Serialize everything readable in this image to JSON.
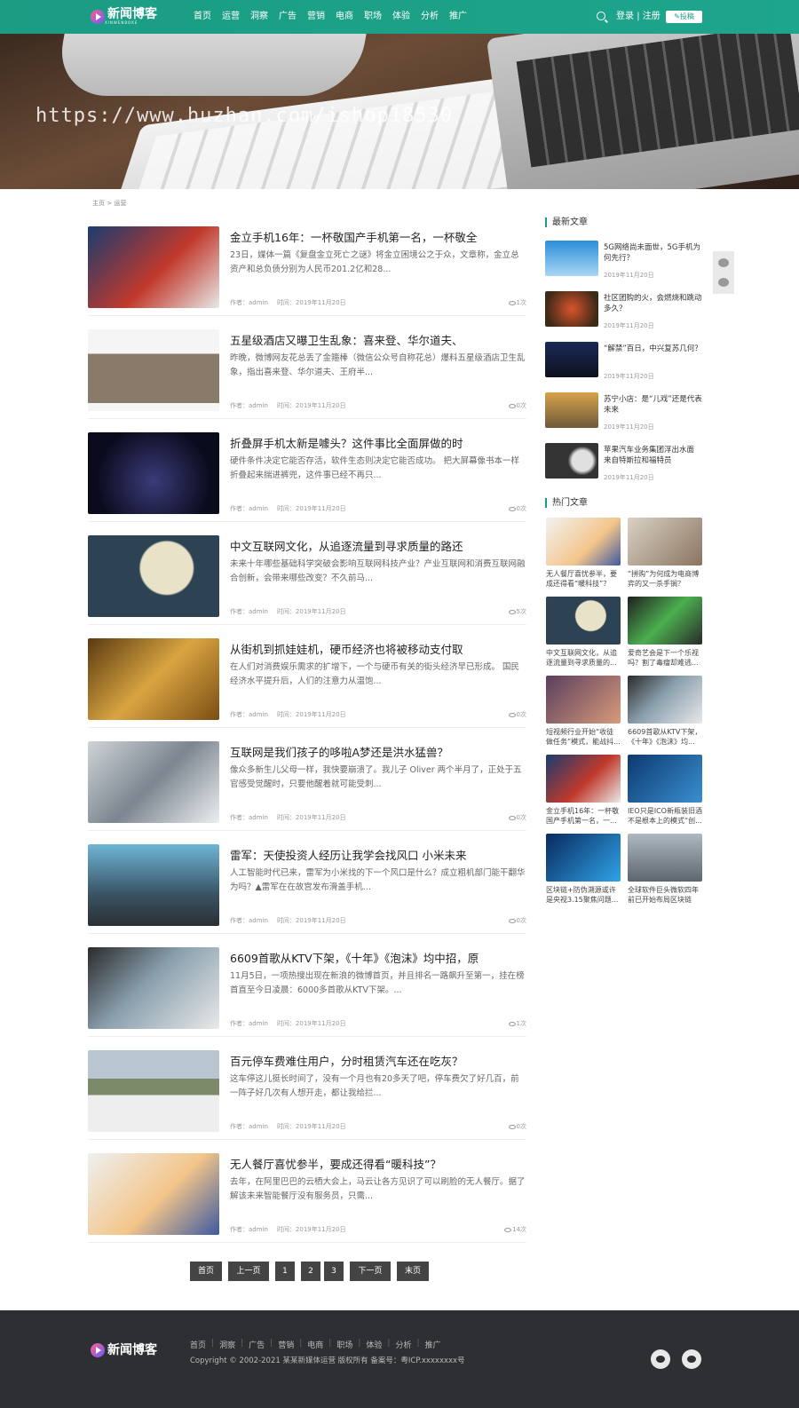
{
  "header": {
    "logo_text": "新闻博客",
    "logo_sub": "XINWENBOKE",
    "nav": [
      "首页",
      "运营",
      "洞察",
      "广告",
      "营销",
      "电商",
      "职场",
      "体验",
      "分析",
      "推广"
    ],
    "login": "登录",
    "sep": "|",
    "register": "注册",
    "post": "✎投稿"
  },
  "banner": {
    "watermark": "https://www.huzhan.com/ishop18530"
  },
  "breadcrumb": "主页 > 运营",
  "articles": [
    {
      "title": "金立手机16年：一杯敬国产手机第一名，一杯敬全",
      "desc": "23日，媒体一篇《复盘金立死亡之谜》将金立困境公之于众，文章称，金立总资产和总负债分别为人民币201.2亿和28...",
      "author": "作者：admin",
      "date": "时间：2019年11月20日",
      "views": "1次"
    },
    {
      "title": "五星级酒店又曝卫生乱象：喜来登、华尔道夫、",
      "desc": "昨晚，微博网友花总丢了金箍棒（微信公众号自称花总）爆料五星级酒店卫生乱象，指出喜来登、华尔道夫、王府半...",
      "author": "作者：admin",
      "date": "时间：2019年11月20日",
      "views": "0次"
    },
    {
      "title": "折叠屏手机太新是噱头？这件事比全面屏做的时",
      "desc": "硬件条件决定它能否存活，软件生态则决定它能否成功。 把大屏幕像书本一样折叠起来揣进裤兜，这件事已经不再只...",
      "author": "作者：admin",
      "date": "时间：2019年11月20日",
      "views": "0次"
    },
    {
      "title": "中文互联网文化，从追逐流量到寻求质量的路还",
      "desc": "未来十年哪些基础科学突破会影响互联网科技产业？产业互联网和消费互联网融合创新，会带来哪些改变？不久前马...",
      "author": "作者：admin",
      "date": "时间：2019年11月20日",
      "views": "5次"
    },
    {
      "title": "从街机到抓娃娃机，硬币经济也将被移动支付取",
      "desc": "在人们对消费娱乐需求的扩增下，一个与硬币有关的街头经济早已形成。 国民经济水平提升后，人们的注意力从温饱...",
      "author": "作者：admin",
      "date": "时间：2019年11月20日",
      "views": "0次"
    },
    {
      "title": "互联网是我们孩子的哆啦A梦还是洪水猛兽？",
      "desc": "像众多新生儿父母一样，我快要崩溃了。我儿子 Oliver 两个半月了，正处于五官感受觉醒时，只要他醒着就可能受刺...",
      "author": "作者：admin",
      "date": "时间：2019年11月20日",
      "views": "0次"
    },
    {
      "title": "雷军：天使投资人经历让我学会找风口 小米未来",
      "desc": "人工智能时代已来，雷军为小米找的下一个风口是什么？成立粗机部门能干翻华为吗？▲雷军在在故宫发布滑盖手机...",
      "author": "作者：admin",
      "date": "时间：2019年11月20日",
      "views": "0次"
    },
    {
      "title": "6609首歌从KTV下架，《十年》《泡沫》均中招，原",
      "desc": "11月5日，一项热搜出现在新浪的微博首页，并且排名一路飙升至第一，挂在榜首直至今日凌晨：6000多首歌从KTV下架。...",
      "author": "作者：admin",
      "date": "时间：2019年11月20日",
      "views": "1次"
    },
    {
      "title": "百元停车费难住用户，分时租赁汽车还在吃灰？",
      "desc": "这车停这儿挺长时间了，没有一个月也有20多天了吧，停车费欠了好几百，前一阵子好几次有人想开走，都让我给拦...",
      "author": "作者：admin",
      "date": "时间：2019年11月20日",
      "views": "0次"
    },
    {
      "title": "无人餐厅喜忧参半，要成还得看“暖科技”？",
      "desc": "去年，在阿里巴巴的云栖大会上，马云让各方见识了可以刷脸的无人餐厅。据了解该未来智能餐厅没有服务员，只需...",
      "author": "作者：admin",
      "date": "时间：2019年11月20日",
      "views": "14次"
    }
  ],
  "pagination": [
    "首页",
    "上一页",
    "1",
    "2",
    "3",
    "下一页",
    "末页"
  ],
  "sidebar": {
    "latest_title": "最新文章",
    "latest": [
      {
        "title": "5G网络尚未面世，5G手机为何先行？",
        "date": "2019年11月20日"
      },
      {
        "title": "社区团购的火，会燃烧和跳动多久？",
        "date": "2019年11月20日"
      },
      {
        "title": "“解禁”百日，中兴复苏几何？",
        "date": "2019年11月20日"
      },
      {
        "title": "苏宁小店：是“儿戏”还是代表未来",
        "date": "2019年11月20日"
      },
      {
        "title": "苹果汽车业务集团浮出水面 来自特斯拉和福特员",
        "date": "2019年11月20日"
      }
    ],
    "hot_title": "热门文章",
    "hot": [
      {
        "title": "无人餐厅喜忧参半，要成还得看“暖科技”？"
      },
      {
        "title": "“拼购”为何成为电商博弈的又一杀手锏？"
      },
      {
        "title": "中文互联网文化，从追逐流量到寻求质量的..."
      },
      {
        "title": "爱奇艺会是下一个乐视吗？割了毒瘤却难逃..."
      },
      {
        "title": "短视频行业开始“收徒做任务”模式，能战抖..."
      },
      {
        "title": "6609首歌从KTV下架，《十年》《泡沫》均..."
      },
      {
        "title": "金立手机16年：一杯敬国产手机第一名，一..."
      },
      {
        "title": "IEO只是ICO新瓶装旧酒 不是根本上的模式“创..."
      },
      {
        "title": "区块链+防伪溯源或许是央视3.15聚焦问题..."
      },
      {
        "title": "全球软件巨头微软四年前已开始布局区块链"
      }
    ]
  },
  "footer": {
    "logo_text": "新闻博客",
    "nav": [
      "首页",
      "洞察",
      "广告",
      "营销",
      "电商",
      "职场",
      "体验",
      "分析",
      "推广"
    ],
    "copyright": "Copyright © 2002-2021 某某新媒体运营 版权所有 备案号：粤ICP.xxxxxxxx号"
  }
}
